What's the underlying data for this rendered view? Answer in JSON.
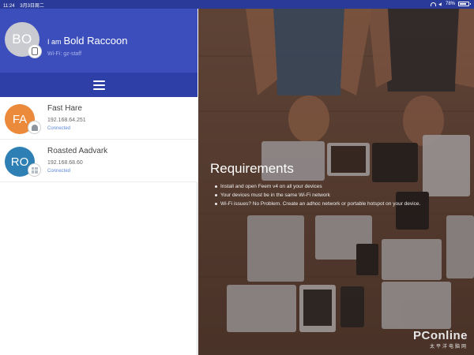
{
  "status_bar": {
    "time": "11:24",
    "date": "3月3日周二",
    "battery_text": "78%",
    "battery_level": 0.78
  },
  "profile": {
    "avatar_initials": "BO",
    "avatar_color": "#c9cbd0",
    "iam_prefix": "I am",
    "name": "Bold Raccoon",
    "wifi_label": "Wi-Fi: gz-staff",
    "device_icon": "tablet-icon"
  },
  "toolbar": {
    "menu_icon": "hamburger-menu-icon"
  },
  "devices": [
    {
      "initials": "FA",
      "avatar_color": "#ec8a3c",
      "name": "Fast Hare",
      "ip": "192.168.64.251",
      "status": "Connected",
      "os_icon": "android-icon"
    },
    {
      "initials": "RO",
      "avatar_color": "#2e7fb4",
      "name": "Roasted Aadvark",
      "ip": "192.168.68.60",
      "status": "Connected",
      "os_icon": "windows-icon"
    }
  ],
  "requirements": {
    "title": "Requirements",
    "items": [
      "Install and open Feem v4 on all your devices",
      "Your devices must be in the same Wi-Fi network",
      "Wi-Fi issues? No Problem. Create an adhoc network or portable hotspot on your device."
    ]
  },
  "watermark": {
    "main": "PConline",
    "sub": "太平洋电脑网"
  },
  "colors": {
    "header_blue": "#3c4ebc",
    "toolbar_blue": "#2f3fa8",
    "status_blue": "#2a3a98",
    "connected": "#5b86d8"
  }
}
